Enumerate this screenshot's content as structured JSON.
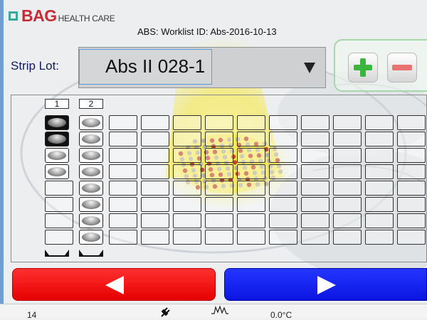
{
  "header": {
    "logo_text": "BAG",
    "logo_subtext": "HEALTH CARE",
    "worklist_title": "ABS: Worklist ID:  Abs-2016-10-13"
  },
  "strip_lot": {
    "label": "Strip Lot:",
    "selected_value": "Abs II 028-1"
  },
  "plate": {
    "columns": 12,
    "rows": 8,
    "strips": [
      {
        "label": "1",
        "wells": 4,
        "selected_wells": 2
      },
      {
        "label": "2",
        "wells": 8,
        "selected_wells": 0
      }
    ]
  },
  "status_bar": {
    "count": "14",
    "temperature": "0.0°C"
  },
  "colors": {
    "brand_red": "#c62b36",
    "brand_teal": "#3aa89a",
    "back_button": "#ff0000",
    "next_button": "#0a12f0",
    "add_green": "#3ab63f",
    "remove_red": "#e8736f"
  },
  "icons": {
    "dropdown": "dropdown-arrow-icon",
    "add": "plus-icon",
    "remove": "minus-icon",
    "back": "arrow-left-icon",
    "next": "arrow-right-icon",
    "connection": "plug-icon",
    "signal": "waveform-icon"
  }
}
